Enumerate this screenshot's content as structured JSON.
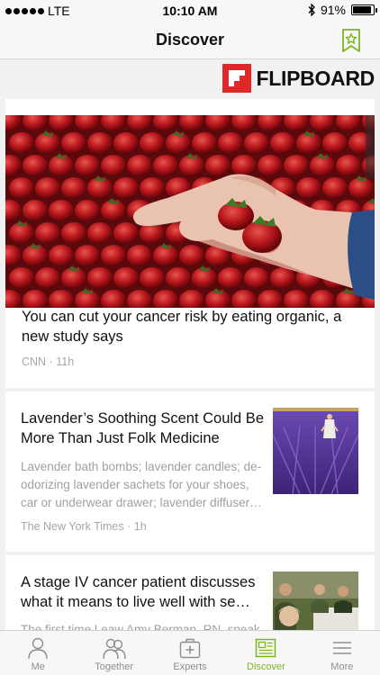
{
  "status_bar": {
    "carrier": "LTE",
    "time": "10:10 AM",
    "battery": "91%",
    "battery_level": 0.91
  },
  "nav": {
    "title": "Discover"
  },
  "brand": {
    "name": "FLIPBOARD",
    "color": "#e12828"
  },
  "articles": [
    {
      "title": "You can cut your cancer risk by eating organic, a new study says",
      "source": "CNN",
      "age": "11h"
    },
    {
      "title": "Lavender’s Soothing Scent Could Be More Than Just Folk Medicine",
      "excerpt": "Lavender bath bombs; lavender candles; de-odorizing lavender sachets for your shoes, car or underwear drawer; lavender diffuser…",
      "source": "The New York Times",
      "age": "1h"
    },
    {
      "title": "A stage IV cancer patient discusses what it means to live well with se…",
      "excerpt": "The first time Leaw Amy Berman, RN, speak…"
    }
  ],
  "tabs": [
    {
      "label": "Me",
      "icon": "person-icon",
      "active": false
    },
    {
      "label": "Together",
      "icon": "people-icon",
      "active": false
    },
    {
      "label": "Experts",
      "icon": "medical-bag-icon",
      "active": false
    },
    {
      "label": "Discover",
      "icon": "news-icon",
      "active": true
    },
    {
      "label": "More",
      "icon": "menu-icon",
      "active": false
    }
  ],
  "colors": {
    "accent": "#7bb61f",
    "inactive": "#8e8e8e",
    "background": "#f1f1f1"
  }
}
